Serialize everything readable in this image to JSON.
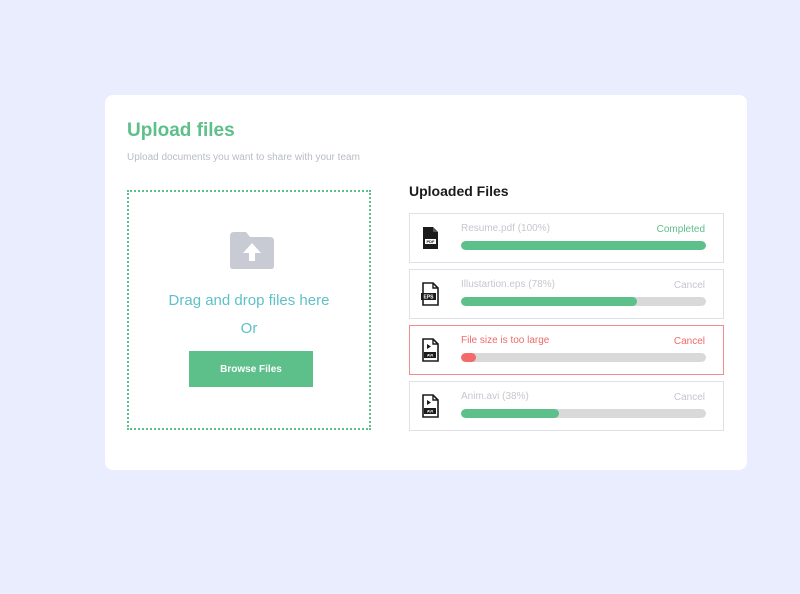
{
  "header": {
    "title": "Upload files",
    "subtitle": "Upload documents you want to share with your team"
  },
  "dropzone": {
    "icon": "folder-upload-icon",
    "text": "Drag and drop files here",
    "or_text": "Or",
    "browse_label": "Browse Files"
  },
  "uploaded": {
    "title": "Uploaded Files",
    "files": [
      {
        "name": "Resume.pdf (100%)",
        "status": "Completed",
        "progress": 1.0,
        "icon": "pdf-file-icon",
        "state": "completed"
      },
      {
        "name": "Illustartion.eps (78%)",
        "status": "Cancel",
        "progress": 0.72,
        "icon": "eps-file-icon",
        "state": "uploading"
      },
      {
        "name": "File size is too large",
        "status": "Cancel",
        "progress": 0.06,
        "icon": "avi-file-icon",
        "state": "error"
      },
      {
        "name": "Anim.avi (38%)",
        "status": "Cancel",
        "progress": 0.4,
        "icon": "avi-file-icon",
        "state": "uploading"
      }
    ]
  },
  "colors": {
    "accent": "#5dbf8a",
    "error": "#f06a6a",
    "background": "#eaedfe",
    "dropzone_text": "#5ec0c9"
  }
}
